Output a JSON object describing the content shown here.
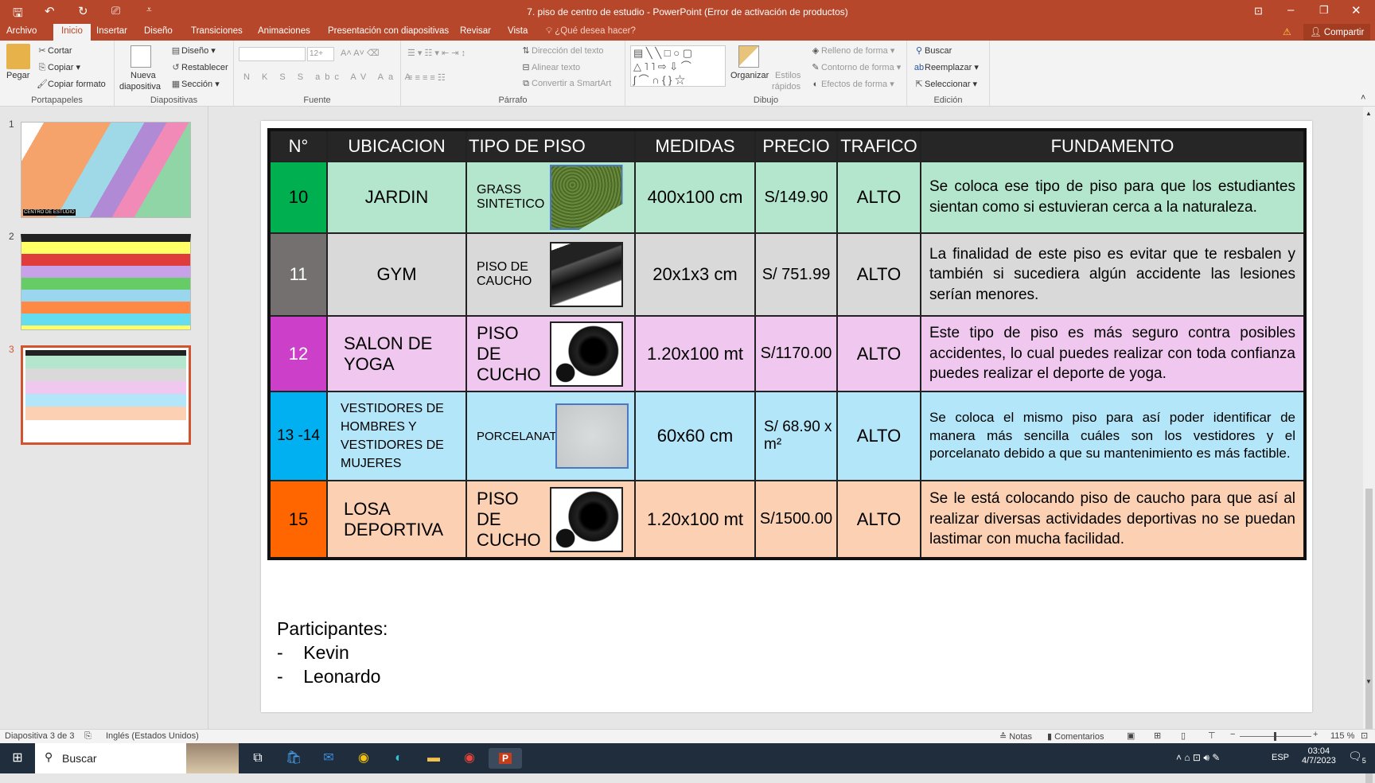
{
  "window": {
    "title": "7. piso de centro de estudio - PowerPoint (Error de activación de productos)",
    "controls": [
      "ribbon-display",
      "minimize",
      "restore",
      "close"
    ]
  },
  "tabs": [
    {
      "label": "Archivo"
    },
    {
      "label": "Inicio",
      "active": true
    },
    {
      "label": "Insertar"
    },
    {
      "label": "Diseño"
    },
    {
      "label": "Transiciones"
    },
    {
      "label": "Animaciones"
    },
    {
      "label": "Presentación con diapositivas"
    },
    {
      "label": "Revisar"
    },
    {
      "label": "Vista"
    }
  ],
  "tell_me": "¿Qué desea hacer?",
  "share": "Compartir",
  "ribbon": {
    "portapapeles": {
      "label": "Portapapeles",
      "pegar": "Pegar",
      "cortar": "Cortar",
      "copiar": "Copiar",
      "copiar_formato": "Copiar formato"
    },
    "diapositivas": {
      "label": "Diapositivas",
      "nueva1": "Nueva",
      "nueva2": "diapositiva",
      "diseno": "Diseño",
      "restablecer": "Restablecer",
      "seccion": "Sección"
    },
    "fuente": {
      "label": "Fuente",
      "font_size": "12+",
      "format_buttons": [
        "N",
        "K",
        "S",
        "S",
        "abc",
        "AV",
        "Aa",
        "A"
      ]
    },
    "parrafo": {
      "label": "Párrafo",
      "direccion": "Dirección del texto",
      "alinear": "Alinear texto",
      "smartart": "Convertir a SmartArt"
    },
    "dibujo": {
      "label": "Dibujo",
      "organizar": "Organizar",
      "estilos1": "Estilos",
      "estilos2": "rápidos",
      "relleno": "Relleno de forma",
      "contorno": "Contorno de forma",
      "efectos": "Efectos de forma"
    },
    "edicion": {
      "label": "Edición",
      "buscar": "Buscar",
      "reemplazar": "Reemplazar",
      "seleccionar": "Seleccionar"
    }
  },
  "thumbnails": [
    {
      "num": "1"
    },
    {
      "num": "2"
    },
    {
      "num": "3",
      "selected": true
    }
  ],
  "thumb1_caption": "CENTRO DE ESTUDIO",
  "table": {
    "headers": [
      "N°",
      "UBICACION",
      "TIPO DE PISO",
      "MEDIDAS",
      "PRECIO",
      "TRAFICO",
      "FUNDAMENTO"
    ],
    "rows": [
      {
        "num": "10",
        "ubicacion": "JARDIN",
        "tipo": "GRASS SINTETICO",
        "image": "grass",
        "medidas": "400x100 cm",
        "precio": "S/149.90",
        "trafico": "ALTO",
        "fundamento": "Se coloca ese tipo de piso para que los estudiantes sientan como si estuvieran cerca a la naturaleza.",
        "color": "#00b050",
        "bg": "#b3e6cc"
      },
      {
        "num": "11",
        "ubicacion": "GYM",
        "tipo": "PISO DE CAUCHO",
        "image": "rubber-roll",
        "medidas": "20x1x3 cm",
        "precio": "S/ 751.99",
        "trafico": "ALTO",
        "fundamento": "La finalidad de este piso es evitar que te resbalen y también si sucediera algún accidente las lesiones serían menores.",
        "color": "#747070",
        "bg": "#d9d9d9"
      },
      {
        "num": "12",
        "ubicacion": "SALON DE YOGA",
        "tipo": "PISO DE CUCHO",
        "image": "rubber-roll-speckled",
        "medidas": "1.20x100 mt",
        "precio": "S/1170.00",
        "trafico": "ALTO",
        "fundamento": "Este tipo de piso es más seguro contra posibles accidentes, lo cual puedes realizar con toda confianza puedes realizar el deporte de yoga.",
        "color": "#cc3fc9",
        "bg": "#f0c7ee"
      },
      {
        "num": "13 -14",
        "ubicacion": "VESTIDORES DE HOMBRES Y VESTIDORES DE MUJERES",
        "tipo": "PORCELANATO",
        "image": "porcelain-tile",
        "medidas": "60x60 cm",
        "precio": "S/ 68.90 x m²",
        "trafico": "ALTO",
        "fundamento": "Se coloca el mismo piso para así poder identificar de manera más sencilla cuáles son los vestidores y el porcelanato debido a que su mantenimiento es más factible.",
        "color": "#00b0f0",
        "bg": "#b3e6f8"
      },
      {
        "num": "15",
        "ubicacion": "LOSA DEPORTIVA",
        "tipo": "PISO DE CUCHO",
        "image": "rubber-roll-speckled",
        "medidas": "1.20x100 mt",
        "precio": "S/1500.00",
        "trafico": "ALTO",
        "fundamento": "Se le está colocando piso de caucho para que así al realizar diversas actividades deportivas no se puedan lastimar con mucha facilidad.",
        "color": "#ff6600",
        "bg": "#fbd0b3"
      }
    ]
  },
  "participants": {
    "title": "Participantes:",
    "items": [
      "Kevin",
      "Leonardo"
    ]
  },
  "status": {
    "slide": "Diapositiva 3 de 3",
    "language": "Inglés (Estados Unidos)",
    "notas": "Notas",
    "comentarios": "Comentarios",
    "zoom": "115 %",
    "zoom_level": 115
  },
  "taskbar": {
    "search": "Buscar",
    "time": "03:04",
    "date": "4/7/2023",
    "lang": "ESP",
    "notifications": "5"
  },
  "colors": {
    "accent": "#b7472a",
    "header": "#262626"
  }
}
